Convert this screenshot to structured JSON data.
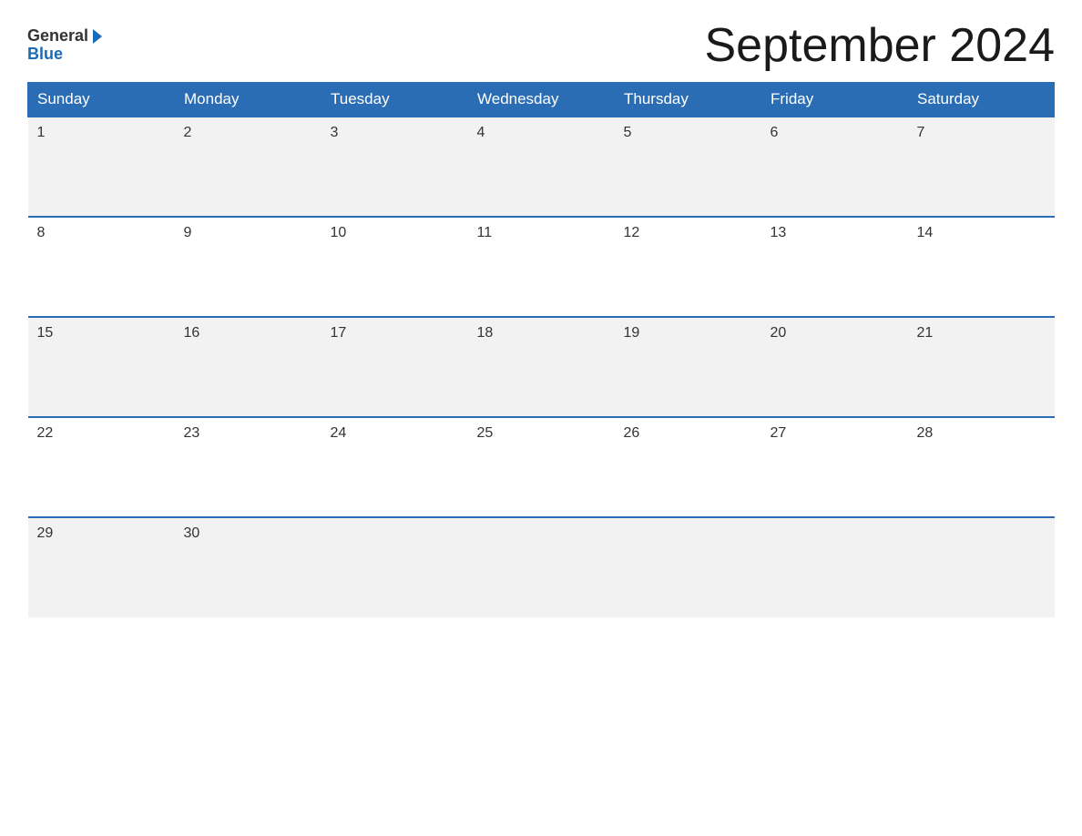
{
  "logo": {
    "general_text": "General",
    "blue_text": "Blue"
  },
  "title": "September 2024",
  "days_of_week": [
    "Sunday",
    "Monday",
    "Tuesday",
    "Wednesday",
    "Thursday",
    "Friday",
    "Saturday"
  ],
  "weeks": [
    [
      "1",
      "2",
      "3",
      "4",
      "5",
      "6",
      "7"
    ],
    [
      "8",
      "9",
      "10",
      "11",
      "12",
      "13",
      "14"
    ],
    [
      "15",
      "16",
      "17",
      "18",
      "19",
      "20",
      "21"
    ],
    [
      "22",
      "23",
      "24",
      "25",
      "26",
      "27",
      "28"
    ],
    [
      "29",
      "30",
      "",
      "",
      "",
      "",
      ""
    ]
  ]
}
